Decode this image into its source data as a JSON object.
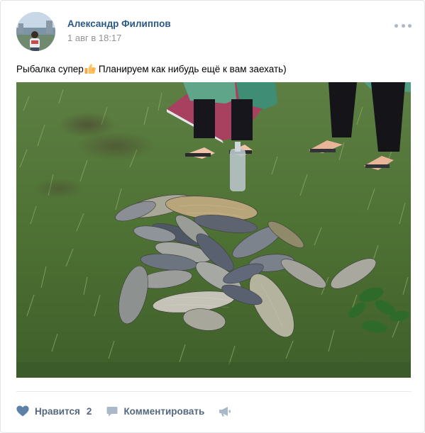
{
  "post": {
    "author": "Александр Филиппов",
    "date": "1 авг в 18:17",
    "text_before": "Рыбалка супер",
    "emoji": "thumbs-up-icon",
    "text_after": " Планируем как нибудь ещё к вам заехать)",
    "photo": "photo of a catch of carp fish on grass"
  },
  "actions": {
    "like_label": "Нравится",
    "like_count": "2",
    "comment_label": "Комментировать"
  },
  "colors": {
    "link": "#2a5885",
    "muted": "#939393",
    "action": "#55677d",
    "icon": "#5e81a8"
  }
}
